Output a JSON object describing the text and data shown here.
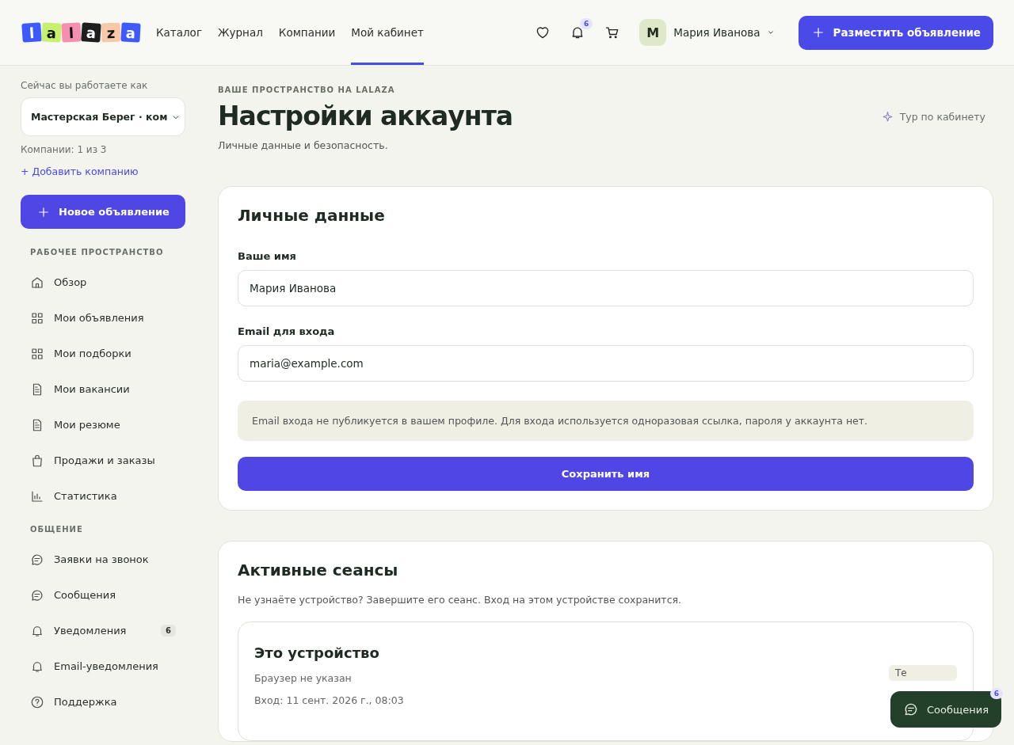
{
  "header": {
    "logo": [
      "l",
      "a",
      "l",
      "a",
      "z",
      "a"
    ],
    "nav": [
      {
        "label": "Каталог",
        "selected": false
      },
      {
        "label": "Журнал",
        "selected": false
      },
      {
        "label": "Компании",
        "selected": false
      },
      {
        "label": "Мой кабинет",
        "selected": true
      }
    ],
    "notifications_badge": "6",
    "user": {
      "initial": "М",
      "name": "Мария Иванова"
    },
    "cta": "Разместить объявление"
  },
  "sidebar": {
    "working_as_label": "Сейчас вы работаете как",
    "company_select": "Мастерская Берег · ком",
    "companies_count": "Компании: 1 из 3",
    "add_company": "+ Добавить компанию",
    "new_listing": "Новое объявление",
    "sections": [
      {
        "title": "РАБОЧЕЕ ПРОСТРАНСТВО",
        "items": [
          {
            "label": "Обзор"
          },
          {
            "label": "Мои объявления"
          },
          {
            "label": "Мои подборки"
          },
          {
            "label": "Мои вакансии"
          },
          {
            "label": "Мои резюме"
          },
          {
            "label": "Продажи и заказы"
          },
          {
            "label": "Статистика"
          }
        ]
      },
      {
        "title": "ОБЩЕНИЕ",
        "items": [
          {
            "label": "Заявки на звонок"
          },
          {
            "label": "Сообщения"
          },
          {
            "label": "Уведомления",
            "badge": "6"
          },
          {
            "label": "Email-уведомления"
          },
          {
            "label": "Поддержка"
          }
        ]
      }
    ]
  },
  "page": {
    "eyebrow": "ВАШЕ ПРОСТРАНСТВО НА LALAZA",
    "title": "Настройки аккаунта",
    "subtitle": "Личные данные и безопасность.",
    "tour_link": "Тур по кабинету"
  },
  "personal": {
    "title": "Личные данные",
    "fields": [
      {
        "label": "Ваше имя",
        "value": "Мария Иванова"
      },
      {
        "label": "Email для входа",
        "value": "maria@example.com"
      }
    ],
    "note": "Email входа не публикуется в вашем профиле. Для входа используется одноразовая ссылка, пароля у аккаунта нет.",
    "save": "Сохранить имя"
  },
  "sessions": {
    "title": "Активные сеансы",
    "hint": "Не узнаёте устройство? Завершите его сеанс. Вход на этом устройстве сохранится.",
    "items": [
      {
        "title": "Это устройство",
        "browser": "Браузер не указан",
        "login": "Вход: 11 сент. 2026 г., 08:03",
        "tag": "Те"
      }
    ]
  },
  "chat_button": {
    "label": "Сообщения",
    "badge": "6"
  }
}
